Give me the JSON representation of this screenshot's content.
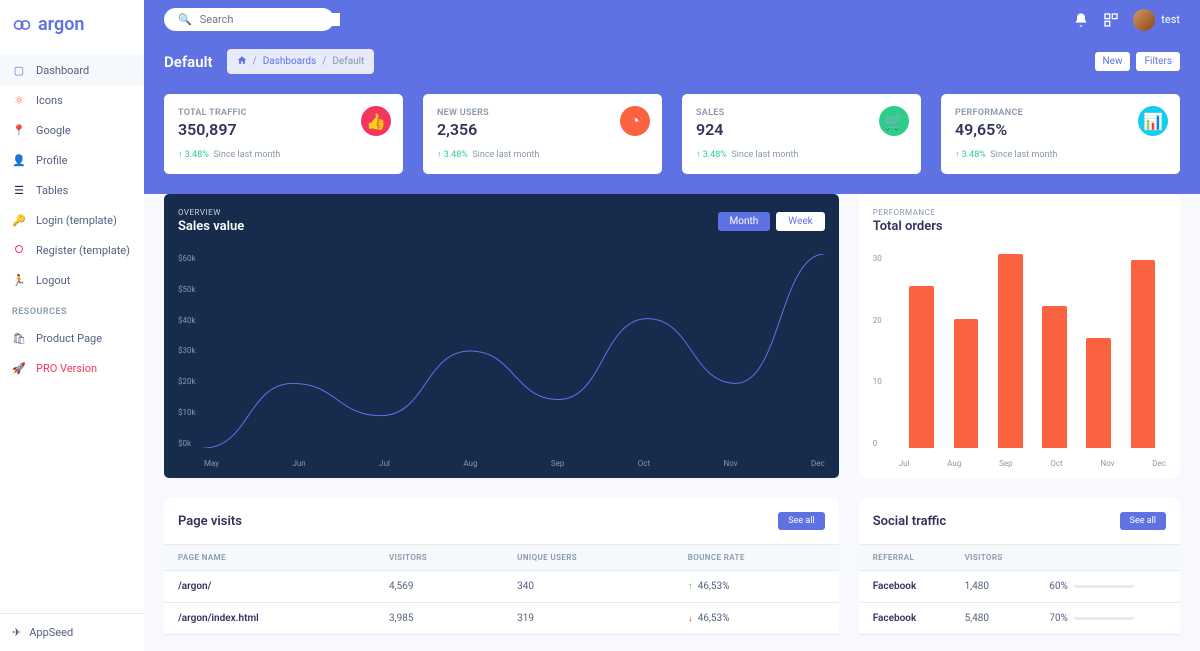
{
  "brand": "argon",
  "search": {
    "placeholder": "Search"
  },
  "user": {
    "name": "test"
  },
  "sidebar": {
    "items": [
      {
        "label": "Dashboard",
        "icon": "tv",
        "color": "#5e72e4",
        "active": true
      },
      {
        "label": "Icons",
        "icon": "atom",
        "color": "#fb6340"
      },
      {
        "label": "Google",
        "icon": "pin",
        "color": "#5e72e4"
      },
      {
        "label": "Profile",
        "icon": "user",
        "color": "#ffd600"
      },
      {
        "label": "Tables",
        "icon": "list",
        "color": "#172b4d"
      },
      {
        "label": "Login (template)",
        "icon": "key",
        "color": "#11cdef"
      },
      {
        "label": "Register (template)",
        "icon": "circle",
        "color": "#f5365c"
      },
      {
        "label": "Logout",
        "icon": "run",
        "color": "#f5365c"
      }
    ],
    "heading": "RESOURCES",
    "resources": [
      {
        "label": "Product Page",
        "icon": "bag",
        "color": "#525f7f"
      },
      {
        "label": "PRO Version",
        "icon": "rocket",
        "color": "#f5365c",
        "pro": true
      }
    ],
    "footer": {
      "label": "AppSeed",
      "icon": "send"
    }
  },
  "header": {
    "title": "Default",
    "breadcrumb": {
      "home": "⌂",
      "link": "Dashboards",
      "current": "Default"
    },
    "buttons": {
      "new": "New",
      "filters": "Filters"
    }
  },
  "stats": [
    {
      "label": "TOTAL TRAFFIC",
      "value": "350,897",
      "change": "3.48%",
      "since": "Since last month",
      "color": "#f5365c",
      "icon": "thumb"
    },
    {
      "label": "NEW USERS",
      "value": "2,356",
      "change": "3.48%",
      "since": "Since last month",
      "color": "#fb6340",
      "icon": "pie"
    },
    {
      "label": "SALES",
      "value": "924",
      "change": "3.48%",
      "since": "Since last month",
      "color": "#2dce89",
      "icon": "cart"
    },
    {
      "label": "PERFORMANCE",
      "value": "49,65%",
      "change": "3.48%",
      "since": "Since last month",
      "color": "#11cdef",
      "icon": "bars"
    }
  ],
  "sales_chart": {
    "overview": "OVERVIEW",
    "title": "Sales value",
    "tabs": {
      "month": "Month",
      "week": "Week"
    }
  },
  "orders_chart": {
    "overview": "PERFORMANCE",
    "title": "Total orders"
  },
  "chart_data": [
    {
      "type": "line",
      "title": "Sales value",
      "xlabel": "",
      "ylabel": "",
      "ylim": [
        0,
        60
      ],
      "yticks": [
        "$0k",
        "$10k",
        "$20k",
        "$30k",
        "$40k",
        "$50k",
        "$60k"
      ],
      "x": [
        "May",
        "Jun",
        "Jul",
        "Aug",
        "Sep",
        "Oct",
        "Nov",
        "Dec"
      ],
      "values": [
        0,
        20,
        10,
        30,
        15,
        40,
        20,
        60
      ]
    },
    {
      "type": "bar",
      "title": "Total orders",
      "xlabel": "",
      "ylabel": "",
      "ylim": [
        0,
        30
      ],
      "yticks": [
        "0",
        "10",
        "20",
        "30"
      ],
      "categories": [
        "Jul",
        "Aug",
        "Sep",
        "Oct",
        "Nov",
        "Dec"
      ],
      "values": [
        25,
        20,
        30,
        22,
        17,
        29
      ]
    }
  ],
  "page_visits": {
    "title": "Page visits",
    "see_all": "See all",
    "columns": [
      "PAGE NAME",
      "VISITORS",
      "UNIQUE USERS",
      "BOUNCE RATE"
    ],
    "rows": [
      {
        "name": "/argon/",
        "visitors": "4,569",
        "unique": "340",
        "dir": "up",
        "rate": "46,53%"
      },
      {
        "name": "/argon/index.html",
        "visitors": "3,985",
        "unique": "319",
        "dir": "down",
        "rate": "46,53%"
      }
    ]
  },
  "social": {
    "title": "Social traffic",
    "see_all": "See all",
    "columns": [
      "REFERRAL",
      "VISITORS",
      ""
    ],
    "rows": [
      {
        "ref": "Facebook",
        "visitors": "1,480",
        "pct": "60%",
        "color": "#f5365c",
        "w": 60
      },
      {
        "ref": "Facebook",
        "visitors": "5,480",
        "pct": "70%",
        "color": "#2dce89",
        "w": 70
      }
    ]
  }
}
